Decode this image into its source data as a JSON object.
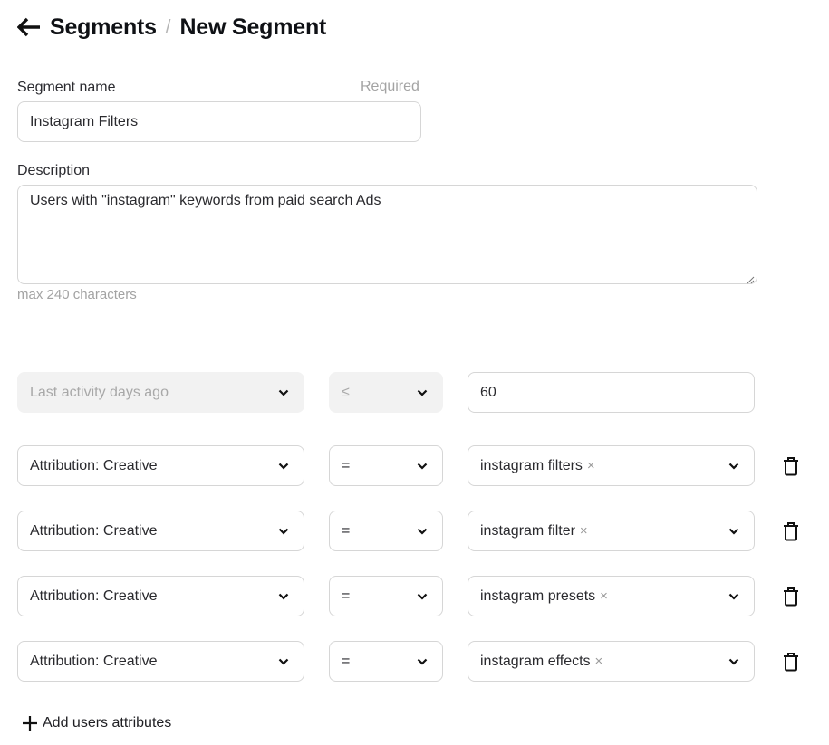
{
  "header": {
    "back_icon": "arrow-left-icon",
    "breadcrumb_root": "Segments",
    "separator": "/",
    "current": "New Segment"
  },
  "form": {
    "name": {
      "label": "Segment name",
      "required_hint": "Required",
      "value": "Instagram Filters"
    },
    "description": {
      "label": "Description",
      "value": "Users with \"instagram\" keywords from paid search Ads",
      "hint": "max 240 characters"
    }
  },
  "conditions": [
    {
      "attribute": "Last activity days ago",
      "operator": "≤",
      "value": "60",
      "disabled": true,
      "value_type": "input"
    },
    {
      "attribute": "Attribution: Creative",
      "operator": "=",
      "value": "instagram filters",
      "value_type": "tag-select",
      "remove_icon": "trash-icon"
    },
    {
      "attribute": "Attribution: Creative",
      "operator": "=",
      "value": "instagram filter",
      "value_type": "tag-select",
      "remove_icon": "trash-icon"
    },
    {
      "attribute": "Attribution: Creative",
      "operator": "=",
      "value": "instagram presets",
      "value_type": "tag-select",
      "remove_icon": "trash-icon"
    },
    {
      "attribute": "Attribution: Creative",
      "operator": "=",
      "value": "instagram effects",
      "value_type": "tag-select",
      "remove_icon": "trash-icon"
    }
  ],
  "tag_remove_glyph": "×",
  "add_button": {
    "icon": "plus-icon",
    "label": "Add users attributes"
  }
}
